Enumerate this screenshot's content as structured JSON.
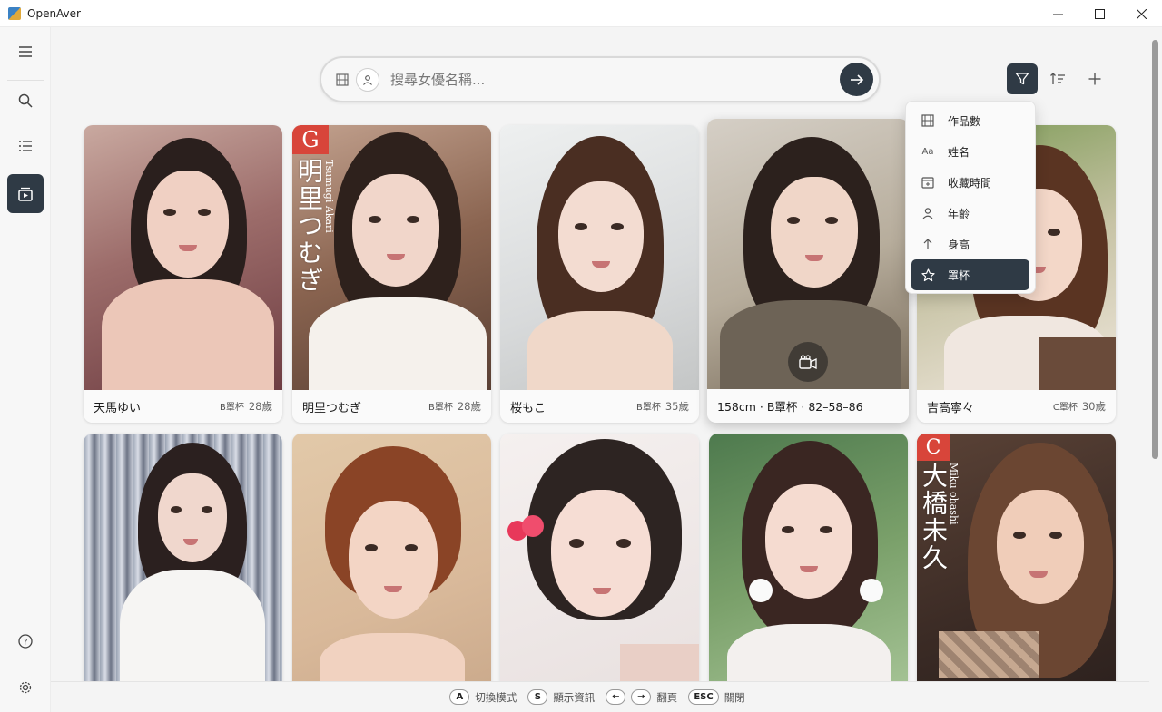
{
  "window": {
    "title": "OpenAver",
    "controls": {
      "minimize": "—",
      "maximize": "☐",
      "close": "✕"
    }
  },
  "sidebar": {
    "items": [
      {
        "name": "menu",
        "icon": "menu-icon"
      },
      {
        "name": "search",
        "icon": "search-icon"
      },
      {
        "name": "list",
        "icon": "list-icon"
      },
      {
        "name": "actresses",
        "icon": "actress-gallery-icon",
        "active": true
      }
    ],
    "bottom": [
      {
        "name": "help",
        "icon": "help-icon"
      },
      {
        "name": "settings",
        "icon": "gear-icon"
      }
    ]
  },
  "search": {
    "placeholder": "搜尋女優名稱...",
    "value": ""
  },
  "toolbar": {
    "filter": {
      "icon": "filter-icon",
      "active": true
    },
    "sort": {
      "icon": "sort-icon"
    },
    "add": {
      "icon": "plus-icon"
    }
  },
  "sort_menu": {
    "items": [
      {
        "label": "作品數",
        "icon": "film-icon"
      },
      {
        "label": "姓名",
        "icon": "text-aa-icon",
        "glyph": "Aa"
      },
      {
        "label": "收藏時間",
        "icon": "calendar-add-icon"
      },
      {
        "label": "年齡",
        "icon": "person-icon"
      },
      {
        "label": "身高",
        "icon": "arrow-up-icon"
      },
      {
        "label": "罩杯",
        "icon": "star-icon",
        "active": true
      }
    ]
  },
  "cards": [
    {
      "name": "天馬ゆい",
      "cup": "B罩杯",
      "age": "28歲"
    },
    {
      "name": "明里つむぎ",
      "cup": "B罩杯",
      "age": "28歲",
      "badge_letter": "G",
      "vertical_name": "明里つむぎ",
      "vertical_roman": "Tsumugi Akari"
    },
    {
      "name": "桜もこ",
      "cup": "B罩杯",
      "age": "35歲"
    },
    {
      "hover_info": "158cm · B罩杯 · 82–58–86",
      "hovered": true
    },
    {
      "name": "吉高寧々",
      "cup": "C罩杯",
      "age": "30歲"
    },
    {
      "name": ""
    },
    {
      "name": ""
    },
    {
      "name": ""
    },
    {
      "name": ""
    },
    {
      "name": "",
      "badge_letter": "C",
      "vertical_name": "大橋未久",
      "vertical_roman": "Miku ohashi"
    }
  ],
  "footer": {
    "hints": [
      {
        "keys": [
          "A"
        ],
        "label": "切換模式"
      },
      {
        "keys": [
          "S"
        ],
        "label": "顯示資訊"
      },
      {
        "keys": [
          "←",
          "→"
        ],
        "label": "翻頁"
      },
      {
        "keys": [
          "ESC"
        ],
        "label": "關閉"
      }
    ]
  },
  "colors": {
    "accent_dark": "#2f3a45",
    "background": "#f4f4f4",
    "card_bg": "#fafafa",
    "badge_red": "#d8453a"
  }
}
